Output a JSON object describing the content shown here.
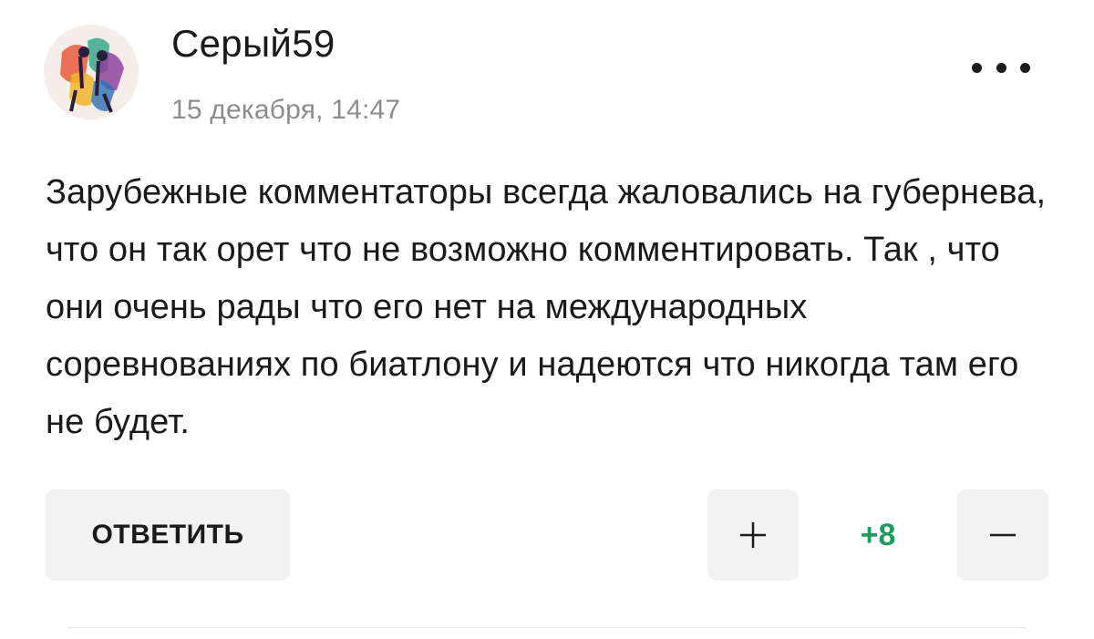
{
  "comment": {
    "author": "Серый59",
    "timestamp": "15 декабря, 14:47",
    "text": "Зарубежные комментаторы всегда жаловались на губернева, что он так орет что не возможно комментировать. Так , что они очень рады что его нет на международных соревнованиях по биатлону и надеются что никогда там его не будет.",
    "more_icon": "more-dots-icon",
    "avatar_icon": "avatar-image"
  },
  "actions": {
    "reply_label": "ОТВЕТИТЬ",
    "upvote_icon": "plus-icon",
    "downvote_icon": "minus-icon",
    "score": "+8"
  },
  "colors": {
    "score": "#1a9c5f",
    "button_bg": "#f2f2f2",
    "timestamp": "#8c8c8c"
  }
}
